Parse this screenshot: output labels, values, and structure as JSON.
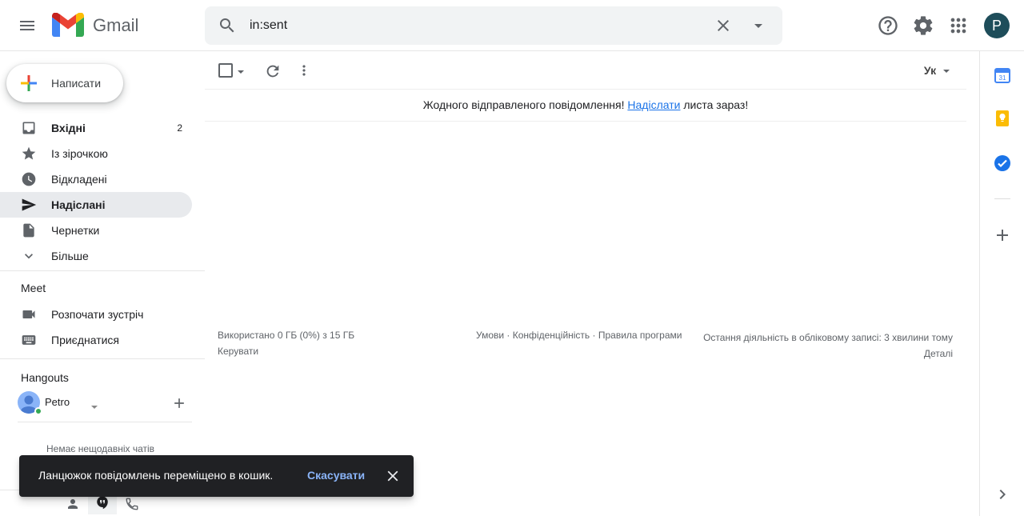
{
  "app": {
    "logo_text": "Gmail"
  },
  "search": {
    "value": "in:sent"
  },
  "account": {
    "avatar_letter": "P"
  },
  "compose": {
    "label": "Написати"
  },
  "nav": [
    {
      "label": "Вхідні",
      "count": "2"
    },
    {
      "label": "Із зірочкою",
      "count": ""
    },
    {
      "label": "Відкладені",
      "count": ""
    },
    {
      "label": "Надіслані",
      "count": ""
    },
    {
      "label": "Чернетки",
      "count": ""
    },
    {
      "label": "Більше",
      "count": ""
    }
  ],
  "meet": {
    "title": "Meet",
    "start": "Розпочати зустріч",
    "join": "Приєднатися"
  },
  "hangouts": {
    "title": "Hangouts",
    "user": "Petro",
    "no_chats": "Немає нещодавніх чатів"
  },
  "toolbar": {
    "lang": "Ук"
  },
  "empty": {
    "before": "Жодного відправленого повідомлення! ",
    "link": "Надіслати",
    "after": " листа зараз!"
  },
  "footer": {
    "storage": "Використано 0 ГБ (0%) з 15 ГБ",
    "manage": "Керувати",
    "terms": "Умови",
    "privacy": "Конфіденційність",
    "policies": "Правила програми",
    "sep": " · ",
    "activity": "Остання діяльність в обліковому записі: 3 хвилини тому",
    "details": "Деталі"
  },
  "rightbar": {
    "calendar_day": "31"
  },
  "snackbar": {
    "message": "Ланцюжок повідомлень переміщено в кошик.",
    "undo": "Скасувати"
  },
  "colors": {
    "accent_blue": "#1a73e8",
    "active_nav": "#e8eaed",
    "snackbar_bg": "#202124",
    "snackbar_link": "#8ab4f8",
    "online_green": "#34a853"
  }
}
